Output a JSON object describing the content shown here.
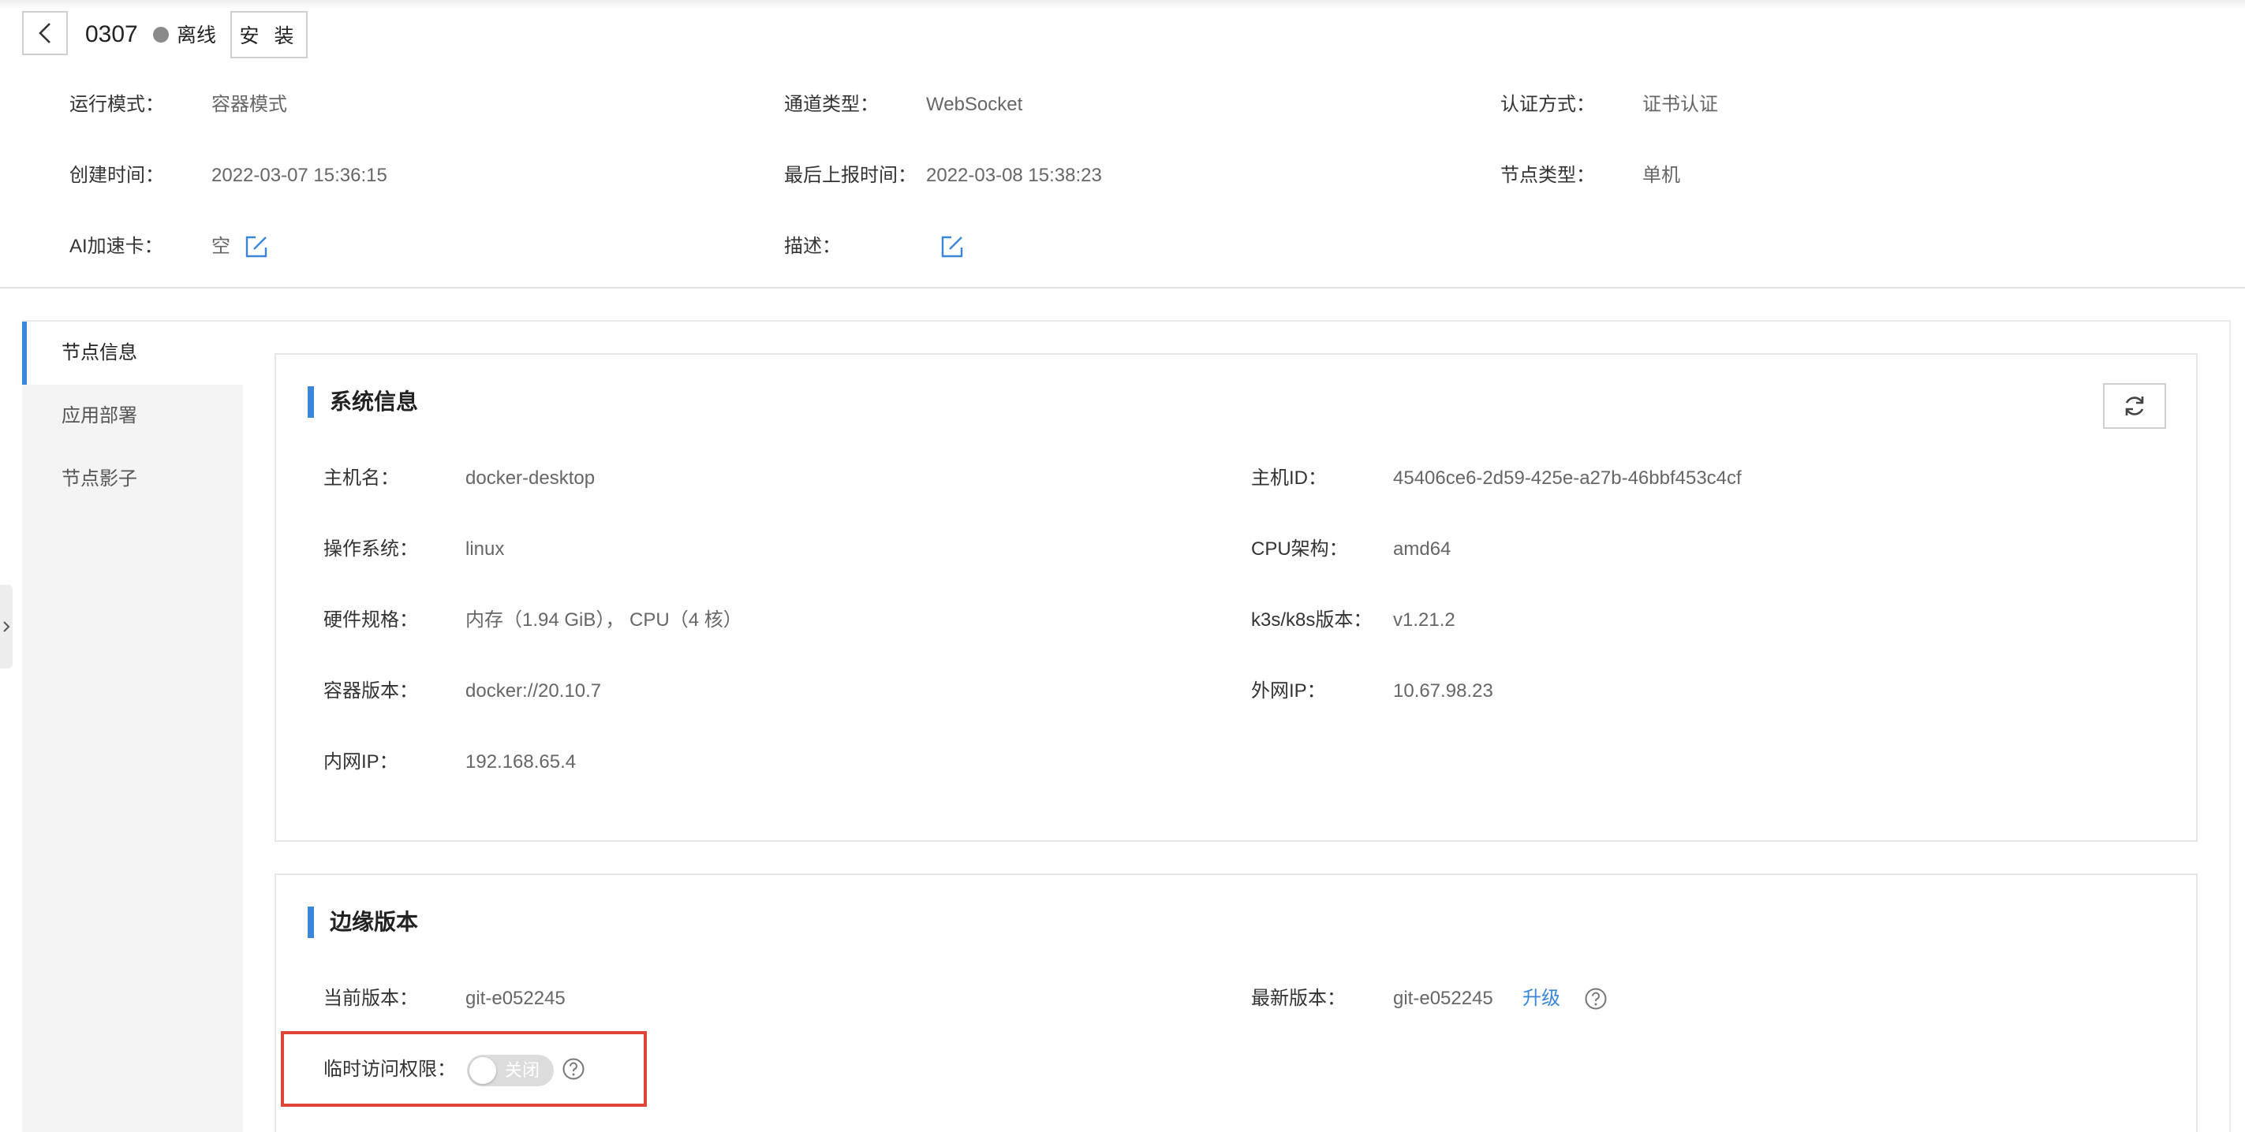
{
  "header": {
    "node_name": "0307",
    "status": "离线",
    "status_color": "#8a8a8a",
    "install_label": "安 装",
    "meta": {
      "run_mode_label": "运行模式：",
      "run_mode_value": "容器模式",
      "channel_label": "通道类型：",
      "channel_value": "WebSocket",
      "auth_label": "认证方式：",
      "auth_value": "证书认证",
      "created_label": "创建时间：",
      "created_value": "2022-03-07 15:36:15",
      "last_report_label": "最后上报时间：",
      "last_report_value": "2022-03-08 15:38:23",
      "node_type_label": "节点类型：",
      "node_type_value": "单机",
      "ai_card_label": "AI加速卡：",
      "ai_card_value": "空",
      "desc_label": "描述：",
      "desc_value": ""
    }
  },
  "sidenav": {
    "items": [
      {
        "label": "节点信息",
        "active": true
      },
      {
        "label": "应用部署",
        "active": false
      },
      {
        "label": "节点影子",
        "active": false
      }
    ]
  },
  "system_info": {
    "title": "系统信息",
    "hostname_label": "主机名：",
    "hostname_value": "docker-desktop",
    "host_id_label": "主机ID：",
    "host_id_value": "45406ce6-2d59-425e-a27b-46bbf453c4cf",
    "os_label": "操作系统：",
    "os_value": "linux",
    "cpu_arch_label": "CPU架构：",
    "cpu_arch_value": "amd64",
    "hw_label": "硬件规格：",
    "hw_value": "内存（1.94 GiB）， CPU（4 核）",
    "k8s_label": "k3s/k8s版本：",
    "k8s_value": "v1.21.2",
    "container_label": "容器版本：",
    "container_value": "docker://20.10.7",
    "public_ip_label": "外网IP：",
    "public_ip_value": "10.67.98.23",
    "private_ip_label": "内网IP：",
    "private_ip_value": "192.168.65.4"
  },
  "edge_version": {
    "title": "边缘版本",
    "current_label": "当前版本：",
    "current_value": "git-e052245",
    "latest_label": "最新版本：",
    "latest_value": "git-e052245",
    "upgrade_label": "升级",
    "temp_access_label": "临时访问权限：",
    "temp_access_toggle": "关闭",
    "temp_access_enabled": false
  },
  "colors": {
    "accent": "#3a86d8",
    "highlight": "#e0453a"
  }
}
